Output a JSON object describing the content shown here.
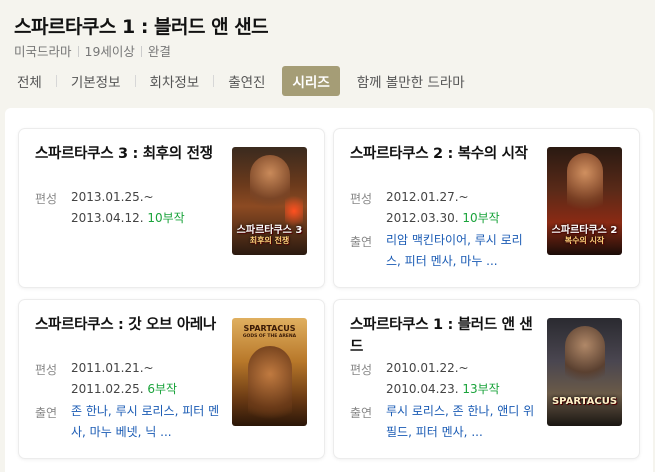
{
  "title": "스파르타쿠스 1 : 블러드 앤 샌드",
  "meta": [
    "미국드라마",
    "19세이상",
    "완결"
  ],
  "tabs": [
    {
      "label": "전체"
    },
    {
      "label": "기본정보"
    },
    {
      "label": "회차정보"
    },
    {
      "label": "출연진"
    },
    {
      "label": "시리즈"
    },
    {
      "label": "함께 볼만한 드라마"
    }
  ],
  "active_tab": "시리즈",
  "labels": {
    "broadcast": "편성",
    "cast": "출연"
  },
  "cards": [
    {
      "title": "스파르타쿠스 3 : 최후의 전쟁",
      "dates_start": "2013.01.25.~",
      "dates_end": "2013.04.12.",
      "episodes": "10부작",
      "cast": "",
      "poster_text": "스파르타쿠스 3",
      "poster_sub": "최후의 전쟁"
    },
    {
      "title": "스파르타쿠스 2 : 복수의 시작",
      "dates_start": "2012.01.27.~",
      "dates_end": "2012.03.30.",
      "episodes": "10부작",
      "cast": "리암 맥킨타이어, 루시 로리스, 피터 멘사, 마누 ...",
      "poster_text": "스파르타쿠스 2",
      "poster_sub": "복수의 시작"
    },
    {
      "title": "스파르타쿠스 : 갓 오브 아레나",
      "dates_start": "2011.01.21.~",
      "dates_end": "2011.02.25.",
      "episodes": "6부작",
      "cast": "존 한나, 루시 로리스, 피터 멘사, 마누 베넷, 닉 ...",
      "poster_text": "SPARTACUS",
      "poster_sub": "GODS OF THE ARENA"
    },
    {
      "title": "스파르타쿠스 1 : 블러드 앤 샌드",
      "dates_start": "2010.01.22.~",
      "dates_end": "2010.04.23.",
      "episodes": "13부작",
      "cast": "루시 로리스, 존 한나, 앤디 위필드, 피터 멘사, ...",
      "poster_text": "SPARTACUS",
      "poster_sub": ""
    }
  ],
  "colors": {
    "accent": "#a59d76",
    "episodes": "#1aa33b",
    "cast_link": "#1a5bb4"
  }
}
